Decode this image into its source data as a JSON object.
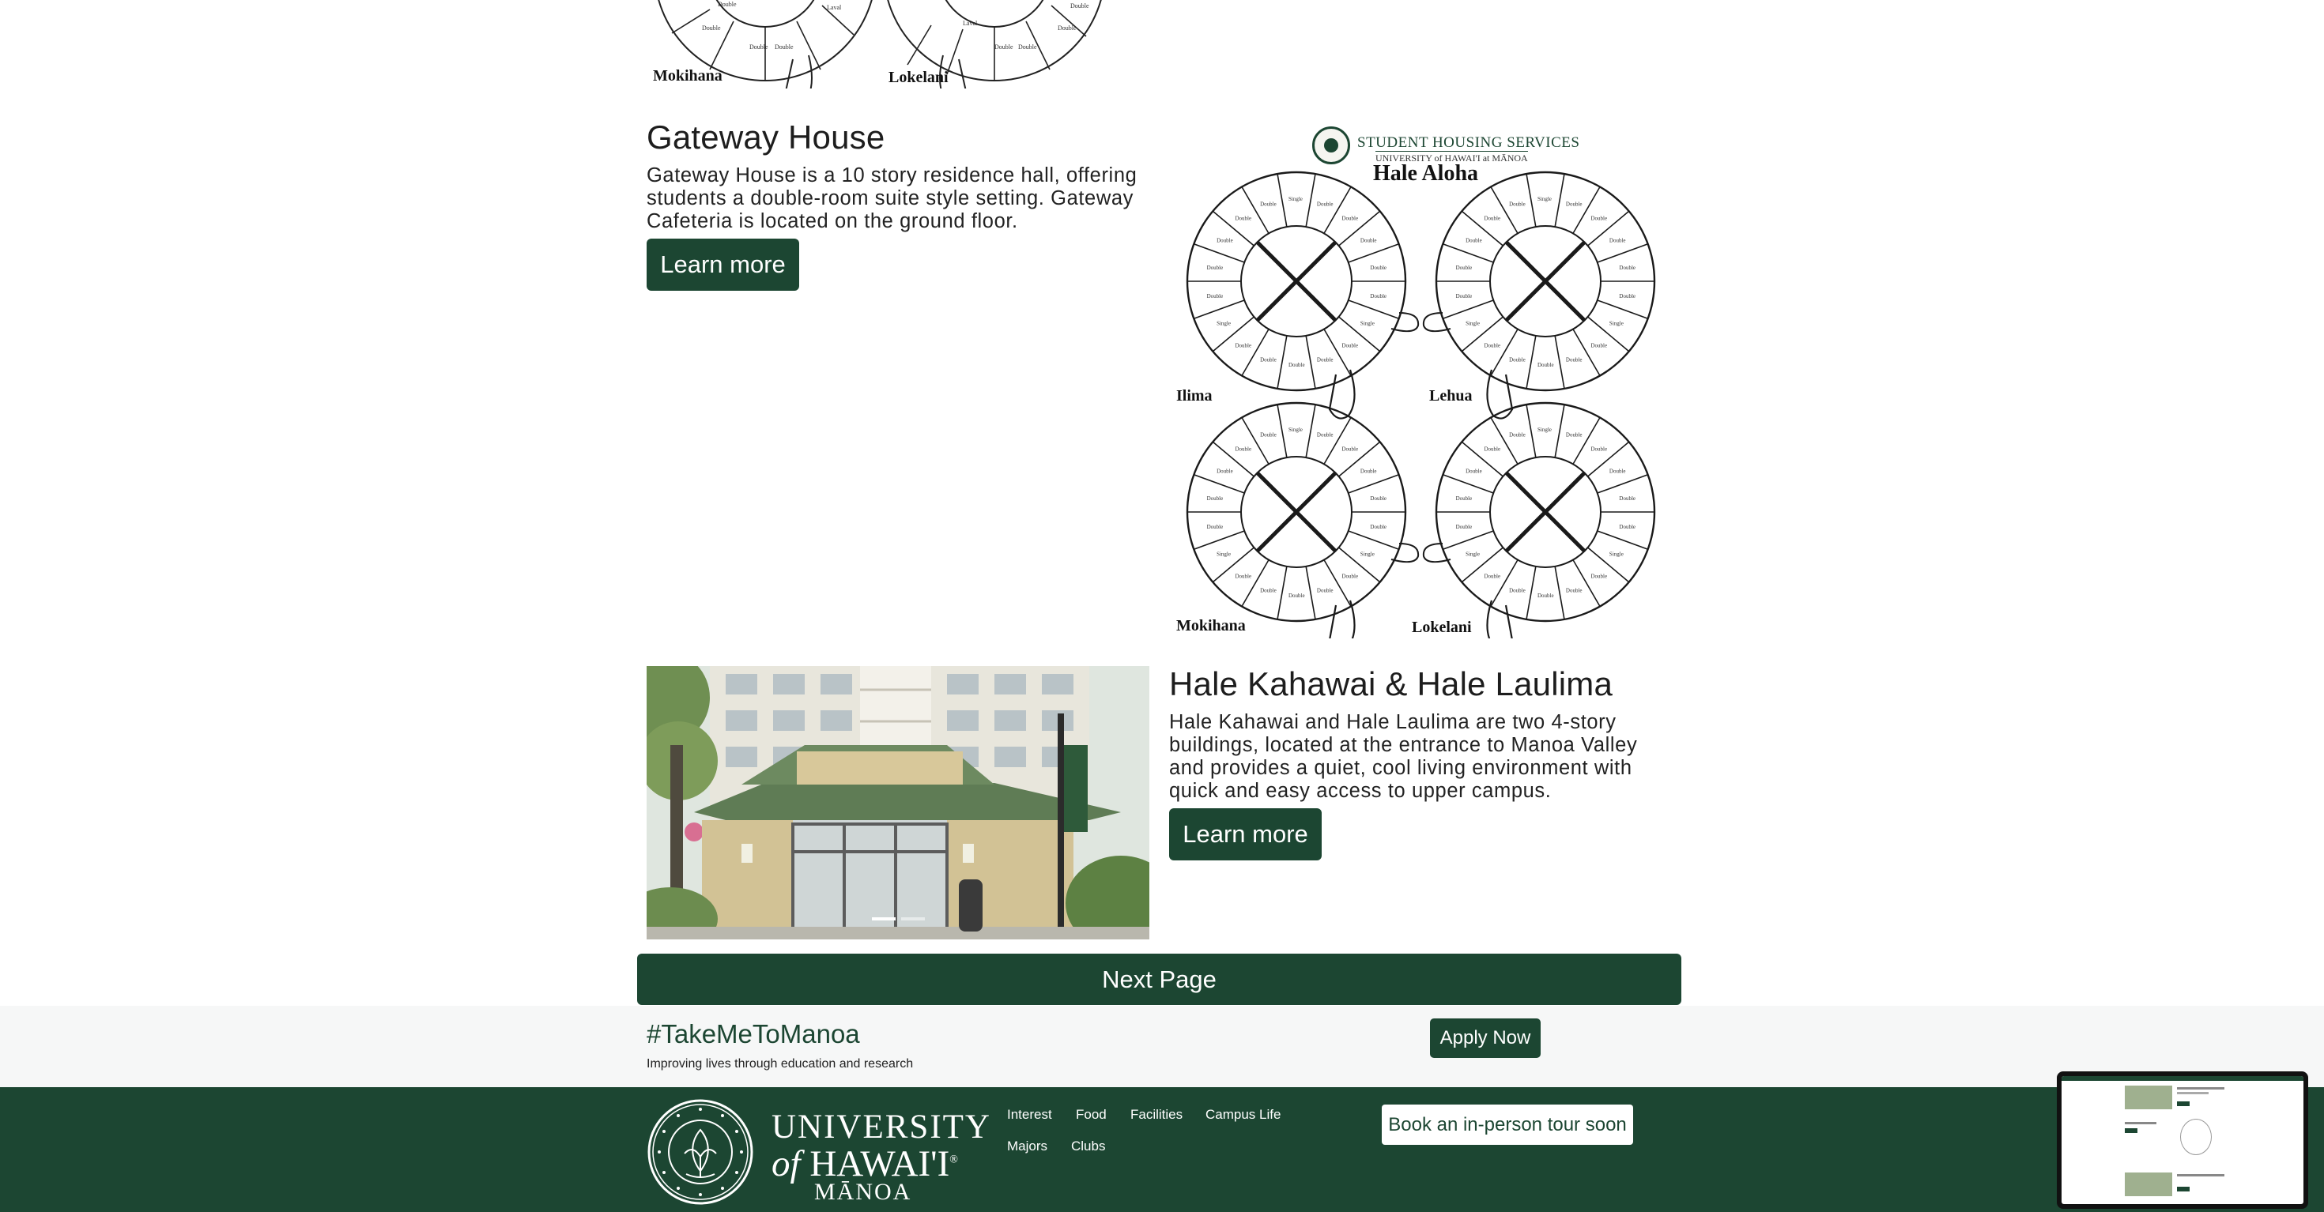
{
  "top_plans": {
    "left_label": "Mokihana",
    "right_label": "Lokelani"
  },
  "gateway": {
    "title": "Gateway House",
    "description": "Gateway House is a 10 story residence hall, offering students a double-room suite style setting. Gateway Cafeteria is located on the ground floor.",
    "button_label": "Learn more"
  },
  "hale_aloha_plan": {
    "org": "STUDENT HOUSING SERVICES",
    "university": "UNIVERSITY of HAWAI'I at MĀNOA",
    "title": "Hale Aloha",
    "towers": [
      "Ilima",
      "Lehua",
      "Mokihana",
      "Lokelani"
    ]
  },
  "kahawai": {
    "title": "Hale Kahawai & Hale Laulima",
    "description": "Hale Kahawai and Hale Laulima are two 4-story buildings, located at the entrance to Manoa Valley and provides a quiet, cool living environment with quick and easy access to upper campus.",
    "button_label": "Learn more"
  },
  "next_page_label": "Next Page",
  "cta": {
    "hashtag": "#TakeMeToManoa",
    "tagline": "Improving lives through education and research",
    "apply_label": "Apply Now"
  },
  "footer": {
    "wordmark_line1": "UNIVERSITY",
    "wordmark_of": "of",
    "wordmark_line2": "HAWAI'I",
    "wordmark_reg": "®",
    "wordmark_line3": "MĀNOA",
    "links": [
      "Interest",
      "Food",
      "Facilities",
      "Campus Life",
      "Majors",
      "Clubs"
    ],
    "tour_button_label": "Book an in-person tour soon"
  },
  "colors": {
    "brand_green": "#1c4632",
    "band_bg": "#f6f7f7",
    "white": "#ffffff"
  }
}
